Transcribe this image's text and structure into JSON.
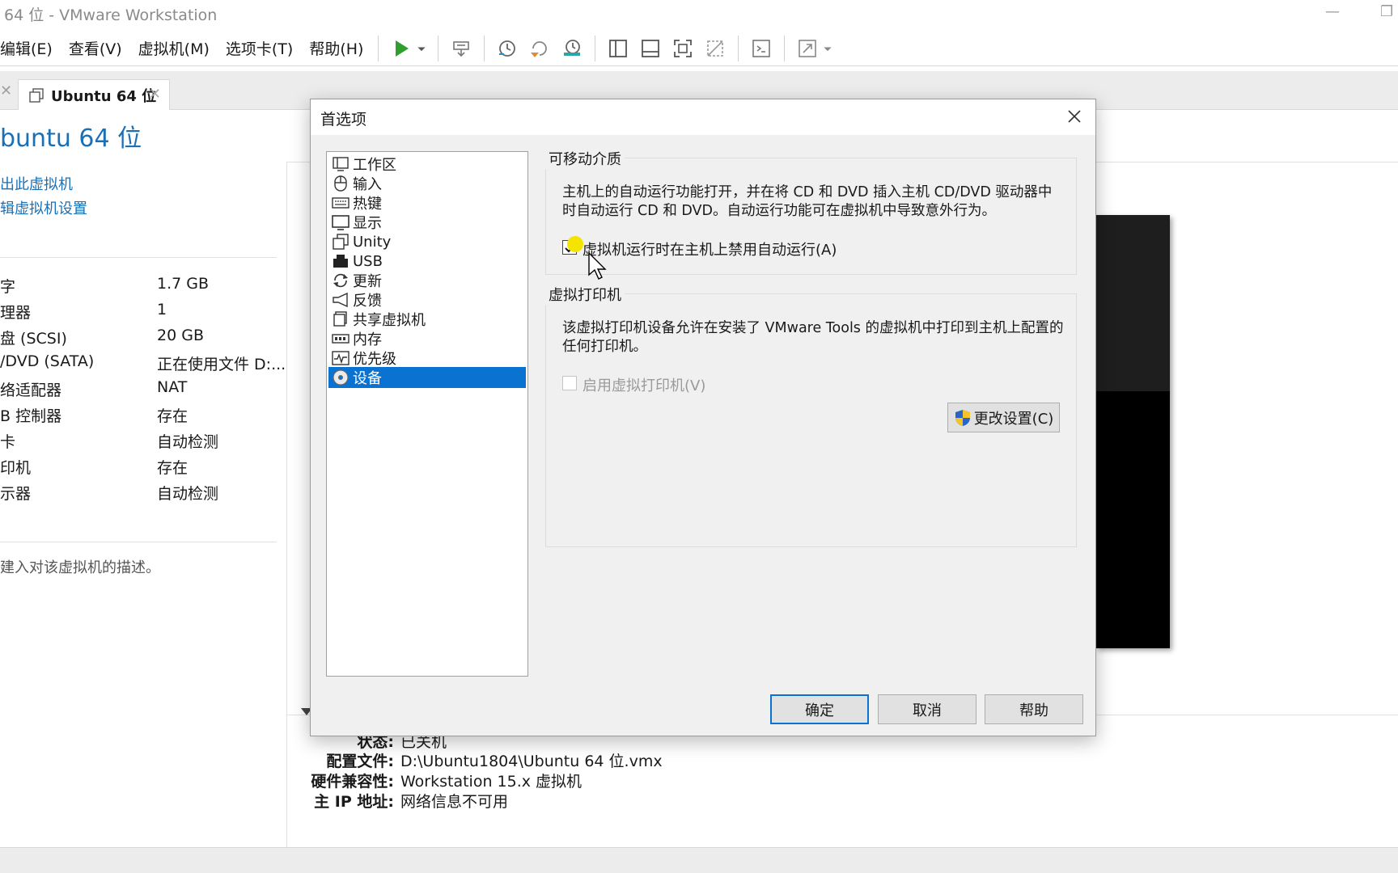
{
  "window": {
    "title": "64 位 - VMware Workstation",
    "minimize_glyph": "—",
    "restore_glyph": "❐"
  },
  "menu": {
    "items": [
      "编辑(E)",
      "查看(V)",
      "虚拟机(M)",
      "选项卡(T)",
      "帮助(H)"
    ]
  },
  "toolbar": {
    "icons": [
      "play-icon",
      "dropdown-arrow-icon",
      "send-keys-icon",
      "snapshot-icon",
      "revert-snapshot-icon",
      "snapshot-manager-icon",
      "library-view-icon",
      "thumbnail-view-icon",
      "fullscreen-icon",
      "unity-icon",
      "console-icon",
      "stretch-icon"
    ],
    "accent_play": "#2e9e2e"
  },
  "tabs": {
    "prev_close": "✕",
    "active_label": "Ubuntu 64 位",
    "active_close": "✕"
  },
  "vm": {
    "title": "buntu 64 位",
    "actions": [
      "出此虚拟机",
      "辑虚拟机设置"
    ],
    "devices": [
      {
        "name": "字",
        "value": "1.7 GB"
      },
      {
        "name": "理器",
        "value": "1"
      },
      {
        "name": "盘 (SCSI)",
        "value": "20 GB"
      },
      {
        "name": "/DVD (SATA)",
        "value": "正在使用文件 D:..."
      },
      {
        "name": "络适配器",
        "value": "NAT"
      },
      {
        "name": "B 控制器",
        "value": "存在"
      },
      {
        "name": "卡",
        "value": "自动检测"
      },
      {
        "name": "印机",
        "value": "存在"
      },
      {
        "name": "示器",
        "value": "自动检测"
      }
    ],
    "description_placeholder": "建入对该虚拟机的描述。"
  },
  "details": {
    "rows": [
      {
        "key": "状态:",
        "value": "已关机"
      },
      {
        "key": "配置文件:",
        "value": "D:\\Ubuntu1804\\Ubuntu 64 位.vmx"
      },
      {
        "key": "硬件兼容性:",
        "value": "Workstation 15.x 虚拟机"
      },
      {
        "key": "主 IP 地址:",
        "value": "网络信息不可用"
      }
    ]
  },
  "dialog": {
    "title": "首选项",
    "nav": [
      {
        "label": "工作区",
        "icon": "workspace-icon"
      },
      {
        "label": "输入",
        "icon": "mouse-icon"
      },
      {
        "label": "热键",
        "icon": "keyboard-icon"
      },
      {
        "label": "显示",
        "icon": "monitor-icon"
      },
      {
        "label": "Unity",
        "icon": "unity-window-icon"
      },
      {
        "label": "USB",
        "icon": "usb-device-icon"
      },
      {
        "label": "更新",
        "icon": "refresh-icon"
      },
      {
        "label": "反馈",
        "icon": "megaphone-icon"
      },
      {
        "label": "共享虚拟机",
        "icon": "shared-vm-icon"
      },
      {
        "label": "内存",
        "icon": "memory-icon"
      },
      {
        "label": "优先级",
        "icon": "priority-icon"
      },
      {
        "label": "设备",
        "icon": "disc-icon"
      }
    ],
    "selected_index": 11,
    "selected_color": "#0a73d2",
    "removable_media": {
      "group_label": "可移动介质",
      "text": "主机上的自动运行功能打开，并在将 CD 和 DVD 插入主机 CD/DVD 驱动器中时自动运行 CD 和 DVD。自动运行功能可在虚拟机中导致意外行为。",
      "checkbox_label": "虚拟机运行时在主机上禁用自动运行(A)",
      "checked": true
    },
    "virtual_printer": {
      "group_label": "虚拟打印机",
      "text": "该虚拟打印机设备允许在安装了 VMware Tools 的虚拟机中打印到主机上配置的任何打印机。",
      "checkbox_label": "启用虚拟打印机(V)",
      "checked": false,
      "enabled": false,
      "change_button": "更改设置(C)"
    },
    "buttons": {
      "ok": "确定",
      "cancel": "取消",
      "help": "帮助"
    }
  }
}
